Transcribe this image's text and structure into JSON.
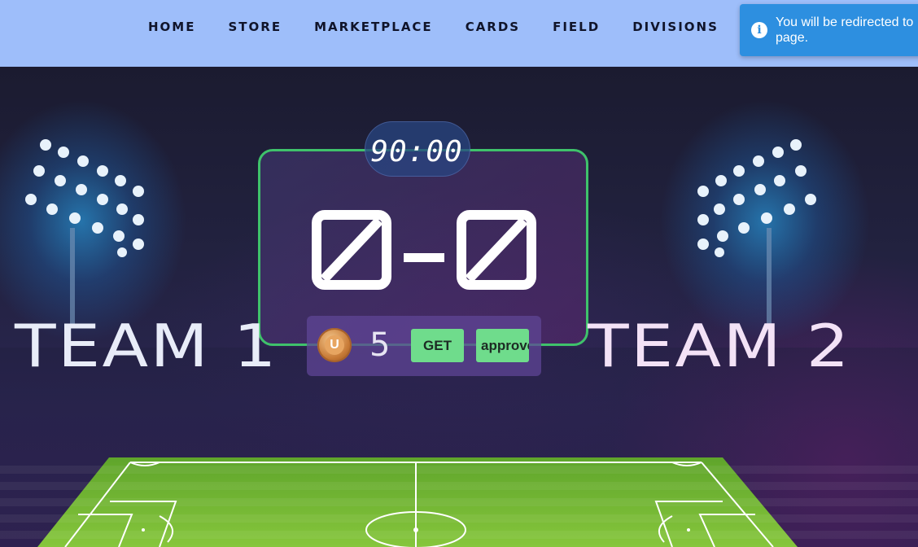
{
  "nav": {
    "items": [
      "HOME",
      "STORE",
      "MARKETPLACE",
      "CARDS",
      "FIELD",
      "DIVISIONS"
    ]
  },
  "toast": {
    "icon": "info-icon",
    "icon_glyph": "i",
    "message": "You will be redirected to page."
  },
  "match": {
    "timer": "90:00",
    "score": "0-0",
    "team_1": "TEAM 1",
    "team_2": "TEAM 2"
  },
  "wallet": {
    "coin_icon": "coin-icon",
    "coin_letter": "U",
    "balance": "5",
    "get_label": "GET",
    "approve_label": "approve"
  },
  "colors": {
    "nav_bg": "#9ebefa",
    "toast_bg": "#2d8fe0",
    "scoreboard_border": "#3fc26b",
    "button_bg": "#6fdc8c",
    "field_green": "#7cc23a"
  }
}
